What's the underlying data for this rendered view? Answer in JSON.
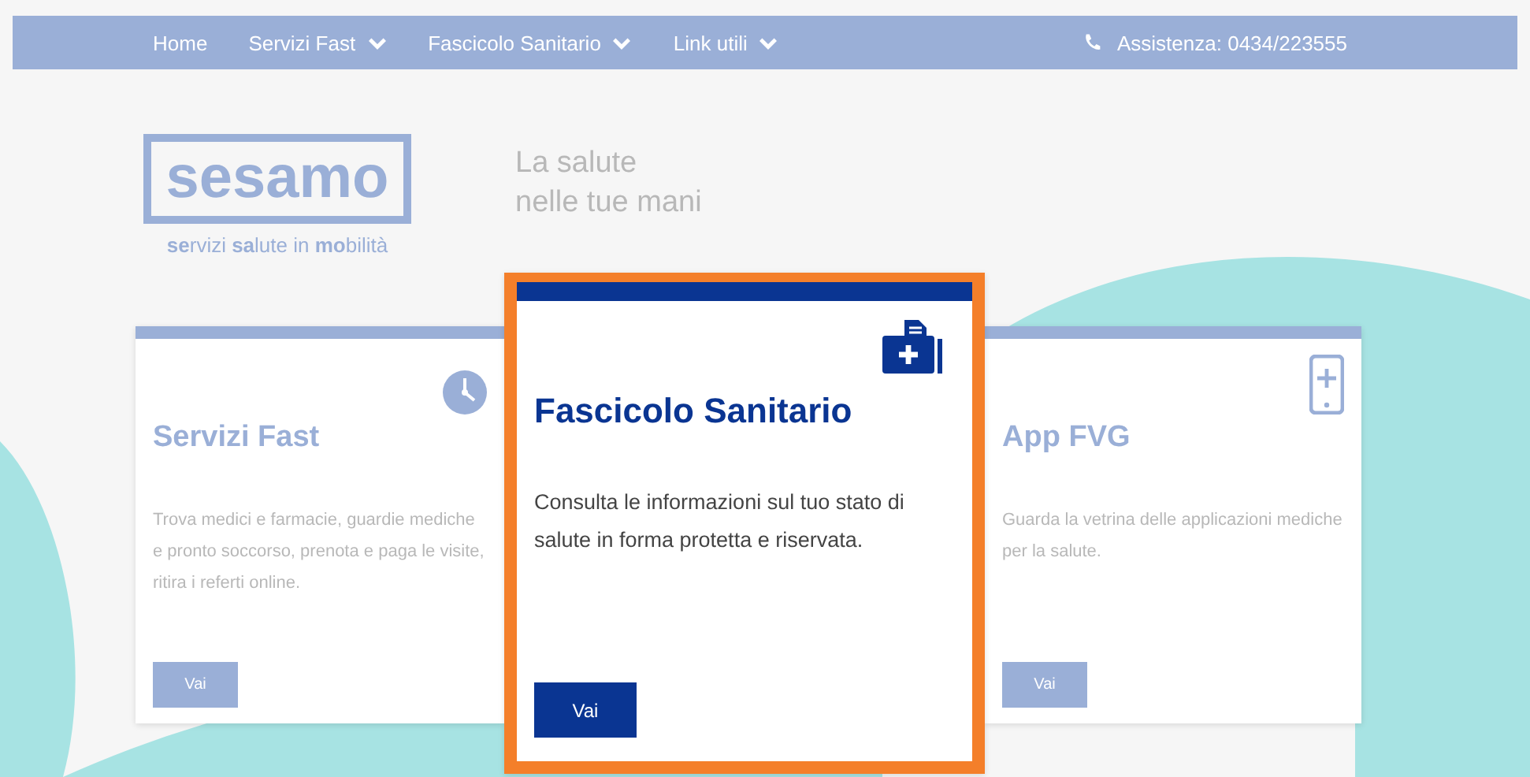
{
  "nav": {
    "items": [
      {
        "label": "Home",
        "dropdown": false
      },
      {
        "label": "Servizi Fast",
        "dropdown": true
      },
      {
        "label": "Fascicolo Sanitario",
        "dropdown": true
      },
      {
        "label": "Link utili",
        "dropdown": true
      }
    ],
    "assistance": "Assistenza: 0434/223555"
  },
  "header": {
    "logo": "sesamo",
    "logo_subtitle": "**se**rvizi **sa**lute in **mo**bilità",
    "tagline": [
      "La salute",
      "nelle tue mani"
    ]
  },
  "cards": [
    {
      "title": "Servizi Fast",
      "description": "Trova medici e farmacie, guardie mediche e pronto soccorso, prenota e paga le visite, ritira i referti online.",
      "button": "Vai",
      "selected": false
    },
    {
      "title": "Fascicolo Sanitario",
      "description": "Consulta le informazioni sul tuo stato di salute in forma protetta e riservata.",
      "button": "Vai",
      "selected": true
    },
    {
      "title": "App FVG",
      "description": "Guarda la vetrina delle applicazioni mediche per la salute.",
      "button": "Vai",
      "selected": false
    }
  ]
}
